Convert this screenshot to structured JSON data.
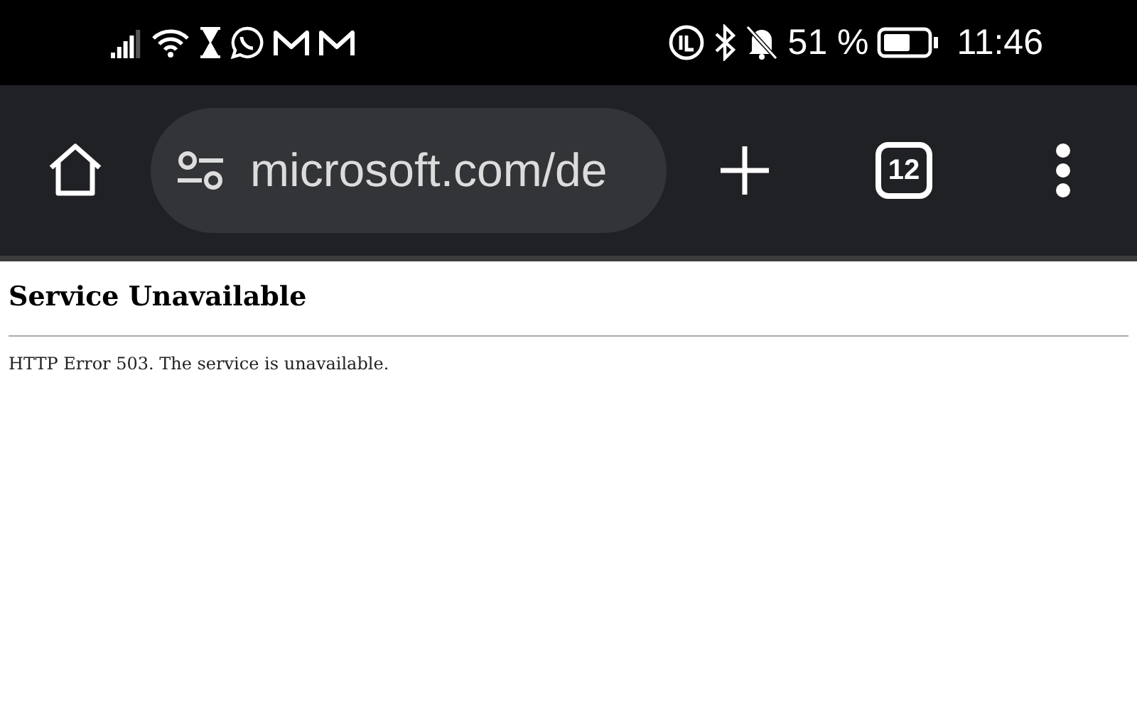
{
  "status_bar": {
    "battery": "51 %",
    "time": "11:46"
  },
  "toolbar": {
    "url": "microsoft.com/de",
    "tab_count": "12"
  },
  "page": {
    "heading": "Service Unavailable",
    "message": "HTTP Error 503. The service is unavailable."
  }
}
